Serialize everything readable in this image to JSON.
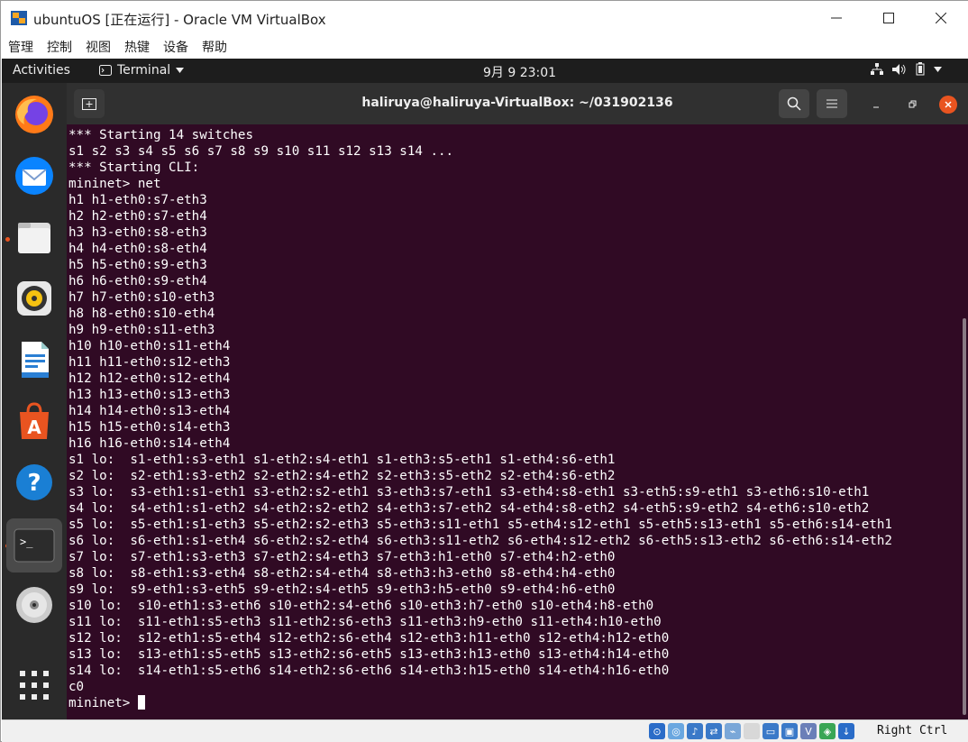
{
  "window": {
    "title": "ubuntuOS [正在运行] - Oracle VM VirtualBox",
    "menu": [
      "管理",
      "控制",
      "视图",
      "热键",
      "设备",
      "帮助"
    ]
  },
  "topbar": {
    "activities": "Activities",
    "app": "Terminal",
    "clock": "9月 9  23:01"
  },
  "terminal": {
    "title": "haliruya@haliruya-VirtualBox: ~/031902136",
    "lines": [
      "*** Starting 14 switches",
      "s1 s2 s3 s4 s5 s6 s7 s8 s9 s10 s11 s12 s13 s14 ...",
      "*** Starting CLI:",
      "mininet> net",
      "h1 h1-eth0:s7-eth3",
      "h2 h2-eth0:s7-eth4",
      "h3 h3-eth0:s8-eth3",
      "h4 h4-eth0:s8-eth4",
      "h5 h5-eth0:s9-eth3",
      "h6 h6-eth0:s9-eth4",
      "h7 h7-eth0:s10-eth3",
      "h8 h8-eth0:s10-eth4",
      "h9 h9-eth0:s11-eth3",
      "h10 h10-eth0:s11-eth4",
      "h11 h11-eth0:s12-eth3",
      "h12 h12-eth0:s12-eth4",
      "h13 h13-eth0:s13-eth3",
      "h14 h14-eth0:s13-eth4",
      "h15 h15-eth0:s14-eth3",
      "h16 h16-eth0:s14-eth4",
      "s1 lo:  s1-eth1:s3-eth1 s1-eth2:s4-eth1 s1-eth3:s5-eth1 s1-eth4:s6-eth1",
      "s2 lo:  s2-eth1:s3-eth2 s2-eth2:s4-eth2 s2-eth3:s5-eth2 s2-eth4:s6-eth2",
      "s3 lo:  s3-eth1:s1-eth1 s3-eth2:s2-eth1 s3-eth3:s7-eth1 s3-eth4:s8-eth1 s3-eth5:s9-eth1 s3-eth6:s10-eth1",
      "s4 lo:  s4-eth1:s1-eth2 s4-eth2:s2-eth2 s4-eth3:s7-eth2 s4-eth4:s8-eth2 s4-eth5:s9-eth2 s4-eth6:s10-eth2",
      "s5 lo:  s5-eth1:s1-eth3 s5-eth2:s2-eth3 s5-eth3:s11-eth1 s5-eth4:s12-eth1 s5-eth5:s13-eth1 s5-eth6:s14-eth1",
      "s6 lo:  s6-eth1:s1-eth4 s6-eth2:s2-eth4 s6-eth3:s11-eth2 s6-eth4:s12-eth2 s6-eth5:s13-eth2 s6-eth6:s14-eth2",
      "s7 lo:  s7-eth1:s3-eth3 s7-eth2:s4-eth3 s7-eth3:h1-eth0 s7-eth4:h2-eth0",
      "s8 lo:  s8-eth1:s3-eth4 s8-eth2:s4-eth4 s8-eth3:h3-eth0 s8-eth4:h4-eth0",
      "s9 lo:  s9-eth1:s3-eth5 s9-eth2:s4-eth5 s9-eth3:h5-eth0 s9-eth4:h6-eth0",
      "s10 lo:  s10-eth1:s3-eth6 s10-eth2:s4-eth6 s10-eth3:h7-eth0 s10-eth4:h8-eth0",
      "s11 lo:  s11-eth1:s5-eth3 s11-eth2:s6-eth3 s11-eth3:h9-eth0 s11-eth4:h10-eth0",
      "s12 lo:  s12-eth1:s5-eth4 s12-eth2:s6-eth4 s12-eth3:h11-eth0 s12-eth4:h12-eth0",
      "s13 lo:  s13-eth1:s5-eth5 s13-eth2:s6-eth5 s13-eth3:h13-eth0 s13-eth4:h14-eth0",
      "s14 lo:  s14-eth1:s5-eth6 s14-eth2:s6-eth6 s14-eth3:h15-eth0 s14-eth4:h16-eth0",
      "c0"
    ],
    "prompt": "mininet> "
  },
  "statusbar": {
    "hostkey": "Right Ctrl"
  },
  "colors": {
    "terminal_bg": "#300a24",
    "ubuntu_orange": "#e95420",
    "close_red": "#e95420"
  },
  "dock_icons": [
    "firefox-icon",
    "thunderbird-icon",
    "files-icon",
    "rhythmbox-icon",
    "writer-icon",
    "software-icon",
    "help-icon",
    "terminal-icon",
    "dvd-icon",
    "apps-grid-icon"
  ]
}
